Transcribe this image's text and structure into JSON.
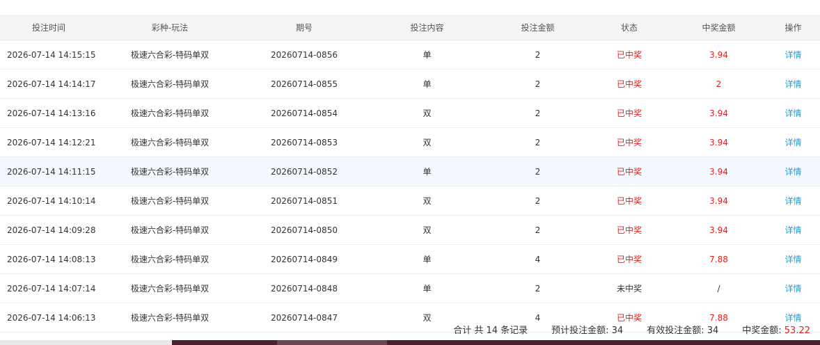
{
  "columns": [
    "投注时间",
    "彩种-玩法",
    "期号",
    "投注内容",
    "投注金额",
    "状态",
    "中奖金额",
    "操作"
  ],
  "rows": [
    {
      "time": "2026-07-14 14:15:15",
      "game": "极速六合彩-特码单双",
      "issue": "20260714-0856",
      "content": "单",
      "amount": "2",
      "status": "已中奖",
      "win": "3.94",
      "action": "详情",
      "won": true
    },
    {
      "time": "2026-07-14 14:14:17",
      "game": "极速六合彩-特码单双",
      "issue": "20260714-0855",
      "content": "单",
      "amount": "2",
      "status": "已中奖",
      "win": "2",
      "action": "详情",
      "won": true
    },
    {
      "time": "2026-07-14 14:13:16",
      "game": "极速六合彩-特码单双",
      "issue": "20260714-0854",
      "content": "双",
      "amount": "2",
      "status": "已中奖",
      "win": "3.94",
      "action": "详情",
      "won": true
    },
    {
      "time": "2026-07-14 14:12:21",
      "game": "极速六合彩-特码单双",
      "issue": "20260714-0853",
      "content": "双",
      "amount": "2",
      "status": "已中奖",
      "win": "3.94",
      "action": "详情",
      "won": true
    },
    {
      "time": "2026-07-14 14:11:15",
      "game": "极速六合彩-特码单双",
      "issue": "20260714-0852",
      "content": "单",
      "amount": "2",
      "status": "已中奖",
      "win": "3.94",
      "action": "详情",
      "won": true
    },
    {
      "time": "2026-07-14 14:10:14",
      "game": "极速六合彩-特码单双",
      "issue": "20260714-0851",
      "content": "双",
      "amount": "2",
      "status": "已中奖",
      "win": "3.94",
      "action": "详情",
      "won": true
    },
    {
      "time": "2026-07-14 14:09:28",
      "game": "极速六合彩-特码单双",
      "issue": "20260714-0850",
      "content": "双",
      "amount": "2",
      "status": "已中奖",
      "win": "3.94",
      "action": "详情",
      "won": true
    },
    {
      "time": "2026-07-14 14:08:13",
      "game": "极速六合彩-特码单双",
      "issue": "20260714-0849",
      "content": "单",
      "amount": "4",
      "status": "已中奖",
      "win": "7.88",
      "action": "详情",
      "won": true
    },
    {
      "time": "2026-07-14 14:07:14",
      "game": "极速六合彩-特码单双",
      "issue": "20260714-0848",
      "content": "单",
      "amount": "2",
      "status": "未中奖",
      "win": "/",
      "action": "详情",
      "won": false
    },
    {
      "time": "2026-07-14 14:06:13",
      "game": "极速六合彩-特码单双",
      "issue": "20260714-0847",
      "content": "双",
      "amount": "4",
      "status": "已中奖",
      "win": "7.88",
      "action": "详情",
      "won": true
    }
  ],
  "highlighted_row": 4,
  "summary": {
    "total_records": "合计 共 14 条记录",
    "expected_bet_label": "预计投注金额: 34",
    "valid_bet_label": "有效投注金额: 34",
    "win_label": "中奖金额: ",
    "win_value": "53.22"
  },
  "colors": {
    "win": "#e02020",
    "link": "#1e9fd6",
    "header_bg": "#f5f5f5",
    "highlight_bg": "#f3f9fe"
  }
}
